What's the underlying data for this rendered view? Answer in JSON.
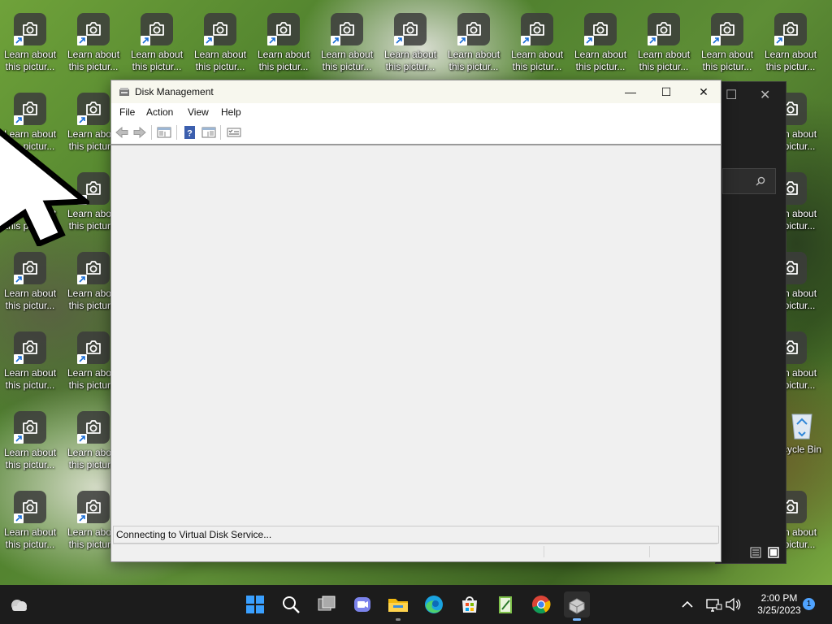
{
  "desktop": {
    "icon_label_line1": "Learn about",
    "icon_label_line2": "this pictur...",
    "recycle_bin_label": "cycle Bin"
  },
  "disk_management": {
    "title": "Disk Management",
    "menu": [
      "File",
      "Action",
      "View",
      "Help"
    ],
    "status_text": "Connecting to Virtual Disk Service...",
    "controls": {
      "minimize": "—",
      "maximize": "☐",
      "close": "✕"
    }
  },
  "background_window": {
    "controls": {
      "maximize": "☐",
      "close": "✕"
    }
  },
  "taskbar": {
    "apps": [
      "weather",
      "start",
      "search",
      "task-view",
      "teams-chat",
      "file-explorer",
      "edge",
      "microsoft-store",
      "notepad",
      "chrome",
      "disk-management"
    ],
    "time": "2:00 PM",
    "date": "3/25/2023",
    "notification_count": "1"
  },
  "colors": {
    "accent": "#0078d4",
    "taskbar": "#1c1c1c"
  }
}
